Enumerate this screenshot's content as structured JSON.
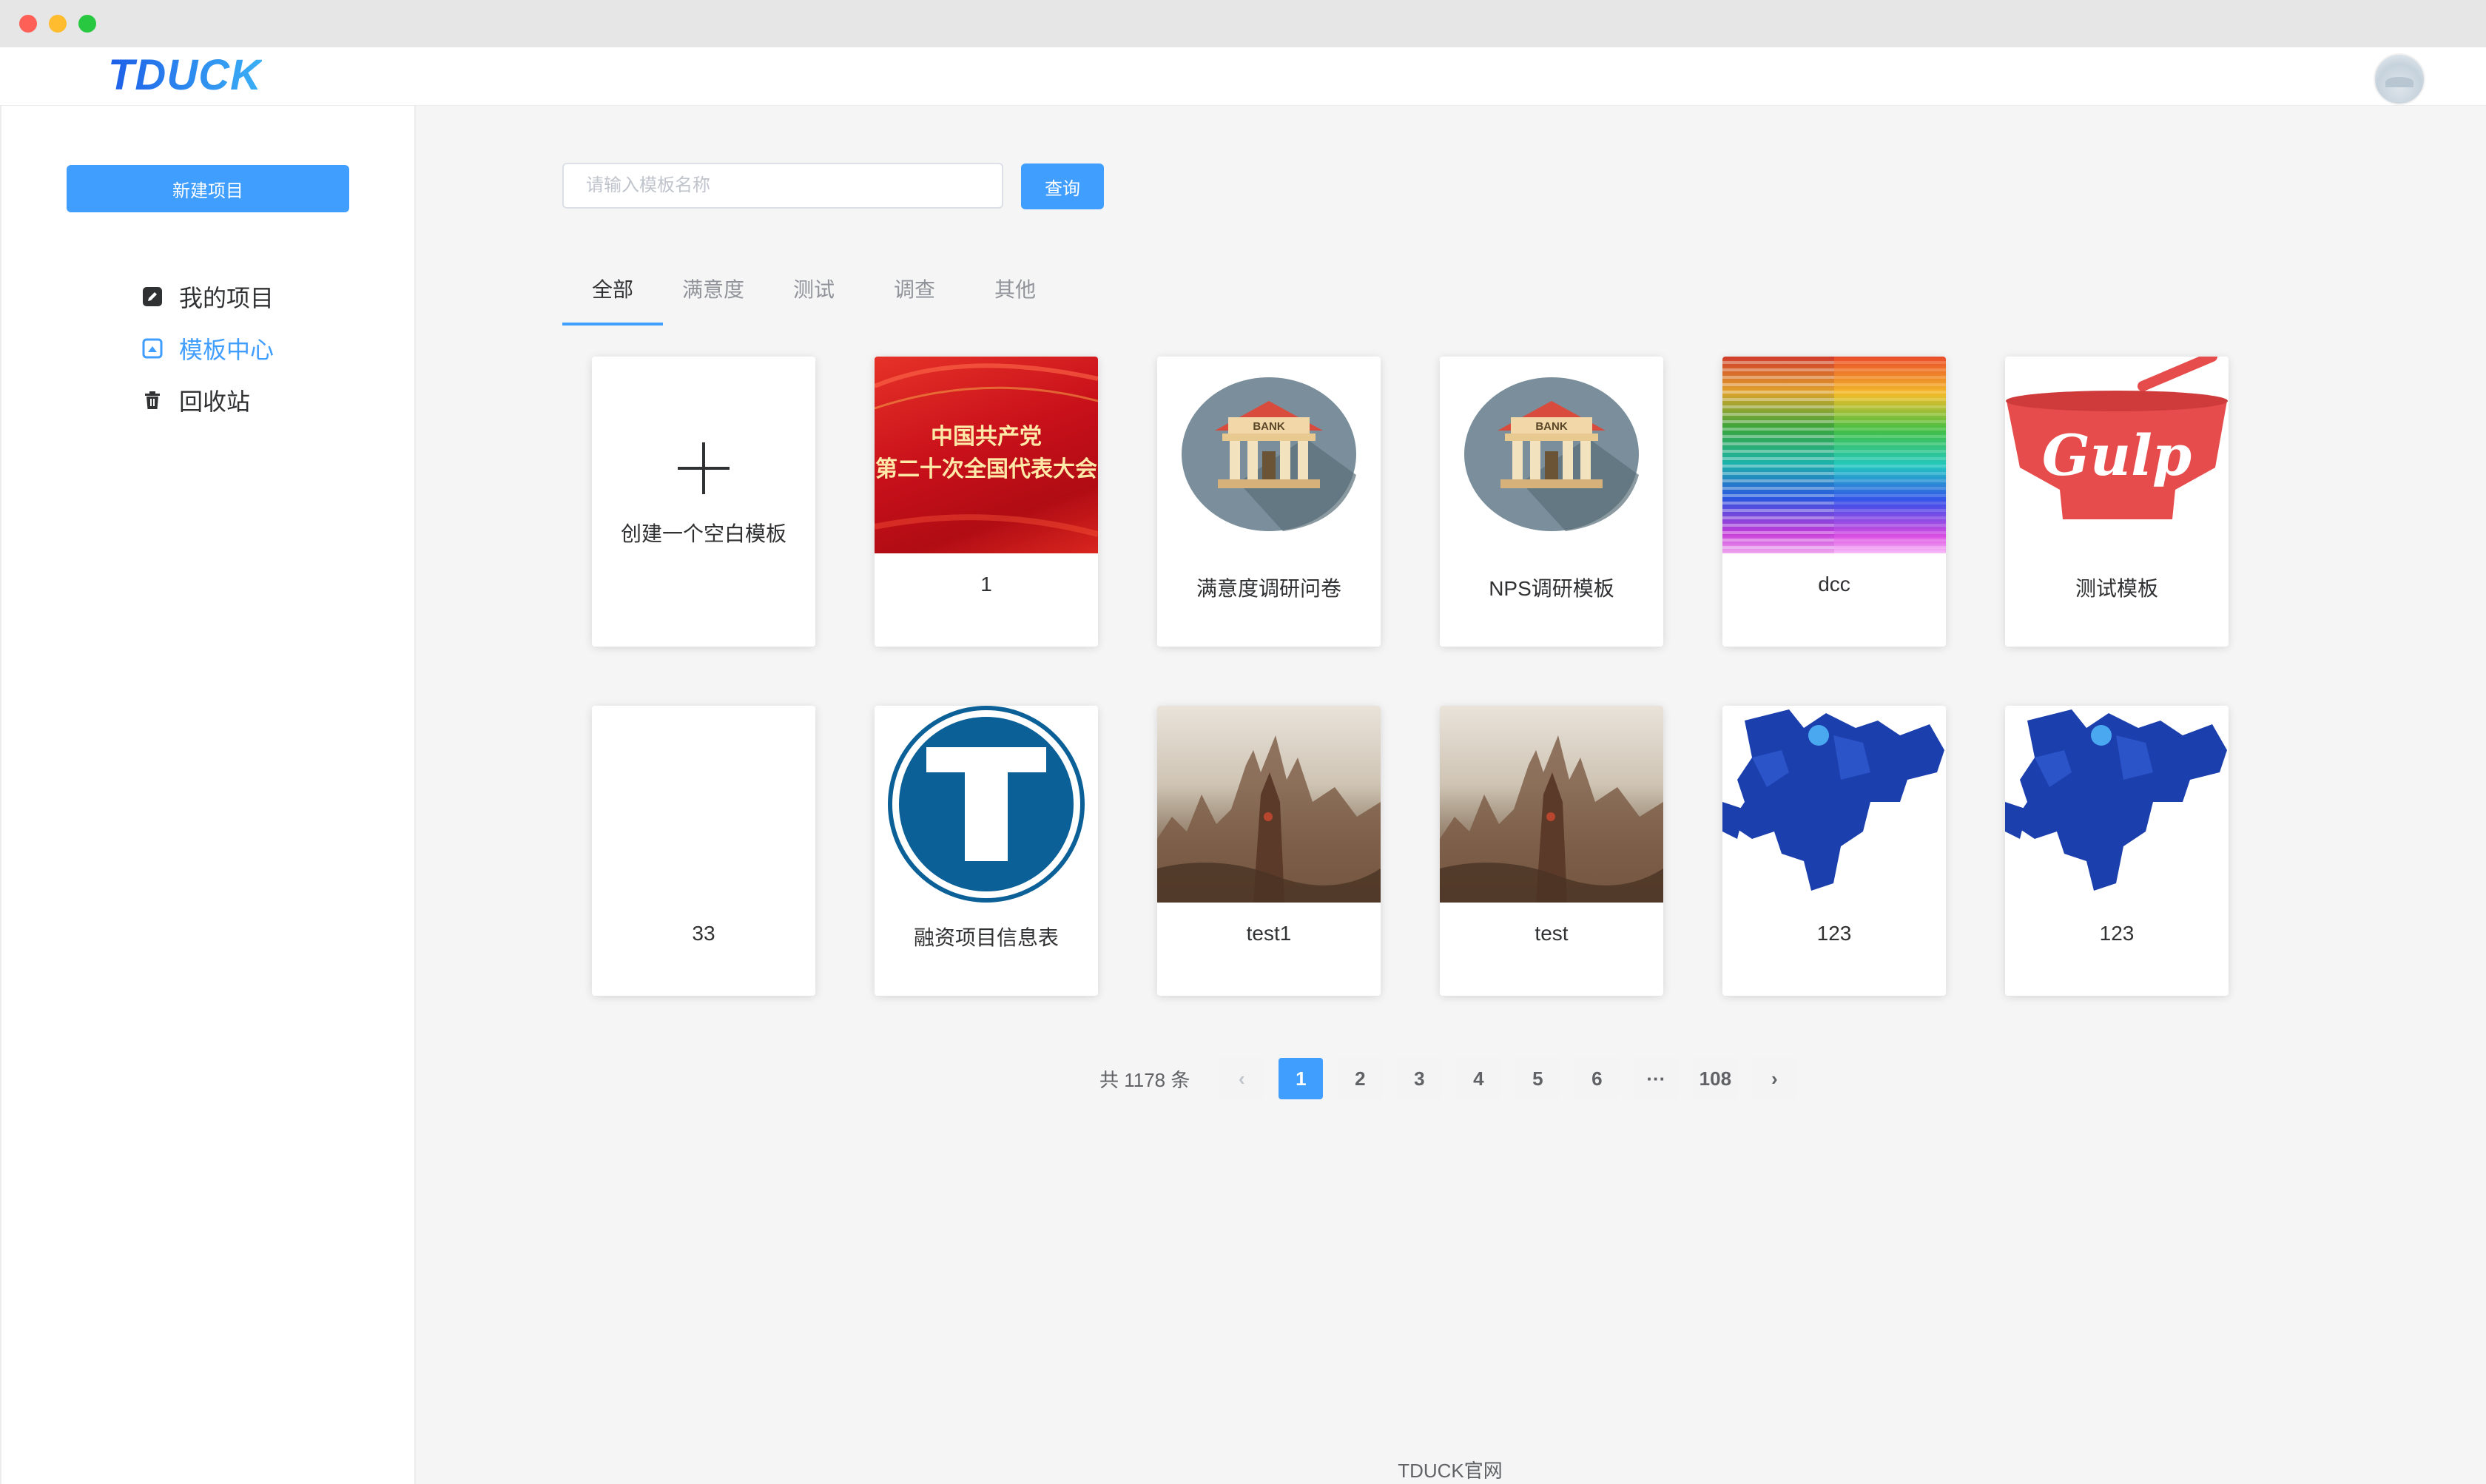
{
  "header": {
    "logo": "TDUCK",
    "avatar_icon": "user-avatar"
  },
  "sidebar": {
    "new_project": "新建项目",
    "items": [
      {
        "label": "我的项目",
        "icon": "edit-icon"
      },
      {
        "label": "模板中心",
        "icon": "template-icon",
        "active": true
      },
      {
        "label": "回收站",
        "icon": "trash-icon"
      }
    ]
  },
  "search": {
    "placeholder": "请输入模板名称",
    "value": "",
    "button": "查询"
  },
  "tabs": [
    {
      "label": "全部",
      "active": true
    },
    {
      "label": "满意度"
    },
    {
      "label": "测试"
    },
    {
      "label": "调查"
    },
    {
      "label": "其他"
    }
  ],
  "templates": {
    "create_blank": "创建一个空白模板",
    "row1": [
      "1",
      "满意度调研问卷",
      "NPS调研模板",
      "dcc",
      "测试模板"
    ],
    "row2": [
      "33",
      "融资项目信息表",
      "test1",
      "test",
      "123",
      "123"
    ],
    "banner_text": [
      "中国共产党",
      "第二十次全国代表大会"
    ],
    "bank_sign": "BANK",
    "gulp_text": "Gulp"
  },
  "pagination": {
    "total": "共 1178 条",
    "pages": [
      "1",
      "2",
      "3",
      "4",
      "5",
      "6"
    ],
    "ellipsis": "···",
    "last": "108",
    "prev": "‹",
    "next": "›",
    "current": 1
  },
  "footer": "TDUCK官网",
  "colors": {
    "primary": "#409eff",
    "text": "#303133",
    "muted": "#909399",
    "bg": "#f5f5f5"
  }
}
